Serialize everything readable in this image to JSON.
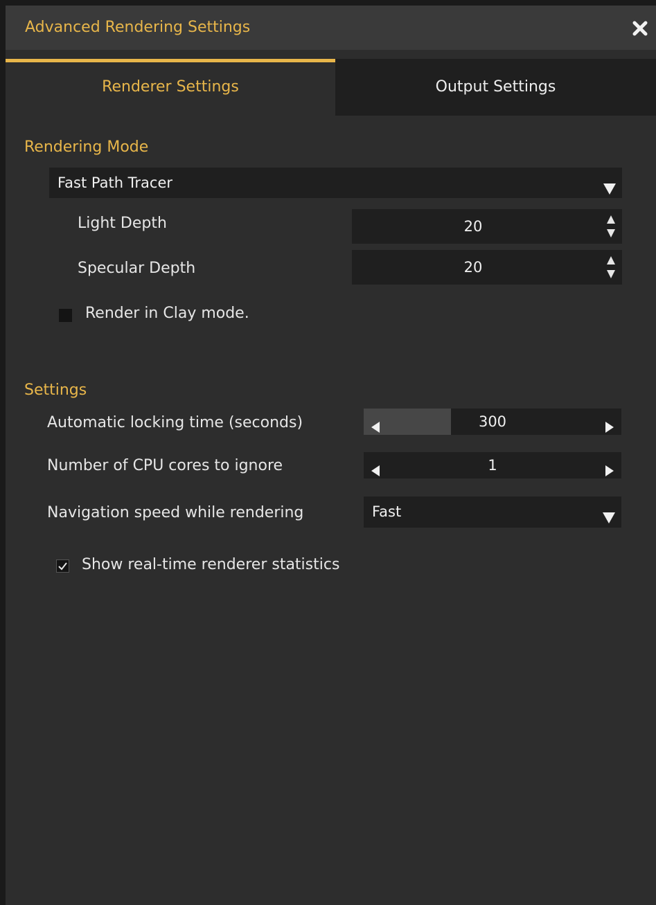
{
  "window": {
    "title": "Advanced Rendering Settings"
  },
  "icons": {
    "close": "close-icon",
    "dropdown_arrow": "triangle-down-icon",
    "spin_arrows": "up-down-arrows-icon",
    "slider_left": "triangle-left-icon",
    "slider_right": "triangle-right-icon",
    "check": "checkmark-icon"
  },
  "tabs": [
    {
      "label": "Renderer Settings",
      "active": true
    },
    {
      "label": "Output Settings",
      "active": false
    }
  ],
  "rendering_mode": {
    "title": "Rendering Mode",
    "mode_value": "Fast Path Tracer",
    "light_depth": {
      "label": "Light Depth",
      "value": "20"
    },
    "specular_depth": {
      "label": "Specular Depth",
      "value": "20"
    },
    "clay_mode": {
      "label": "Render in Clay mode.",
      "checked": false
    }
  },
  "settings": {
    "title": "Settings",
    "locking_time": {
      "label": "Automatic locking time (seconds)",
      "value": "300",
      "fill_fraction": 0.34
    },
    "cpu_cores": {
      "label": "Number of CPU cores to ignore",
      "value": "1"
    },
    "nav_speed": {
      "label": "Navigation speed while rendering",
      "value": "Fast"
    },
    "show_stats": {
      "label": "Show real-time renderer statistics",
      "checked": true
    }
  },
  "colors": {
    "accent": "#e8b64a",
    "background": "#2d2d2d",
    "field": "#1f1f1f",
    "titlebar": "#3a3a3a"
  }
}
